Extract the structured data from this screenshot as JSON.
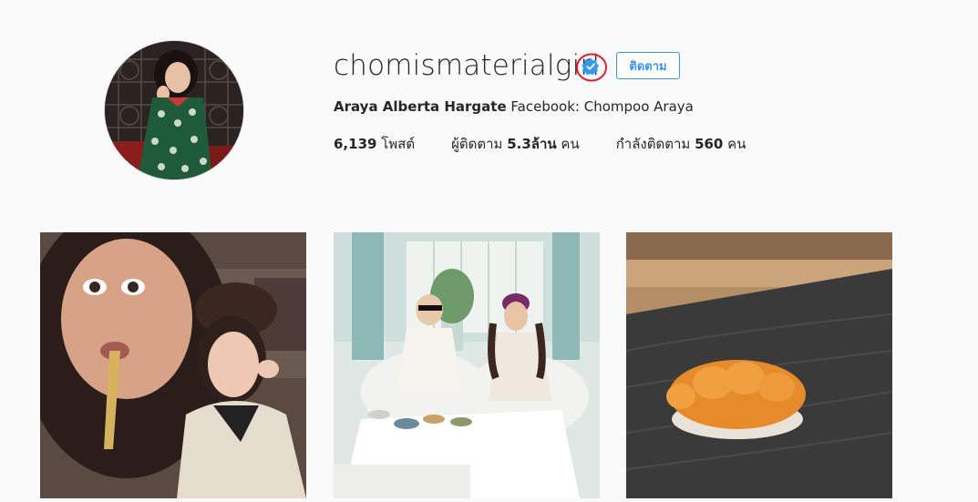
{
  "profile": {
    "username": "chomismaterialgirl",
    "verified": true,
    "follow_button": "ติดตาม",
    "full_name": "Araya Alberta Hargate",
    "bio_text": "Facebook: Chompoo Araya"
  },
  "stats": {
    "posts_count": "6,139",
    "posts_label": "โพสต์",
    "followers_label": "ผู้ติดตาม",
    "followers_count": "5.3ล้าน",
    "followers_unit": "คน",
    "following_label": "กำลังติดตาม",
    "following_count": "560",
    "following_unit": "คน"
  },
  "colors": {
    "accent": "#3897f0",
    "verified_badge": "#3897f0",
    "highlight_circle": "#e0202a"
  },
  "posts": [
    {
      "id": "selfie-spoon"
    },
    {
      "id": "tea-party"
    },
    {
      "id": "sushi-uni"
    }
  ]
}
